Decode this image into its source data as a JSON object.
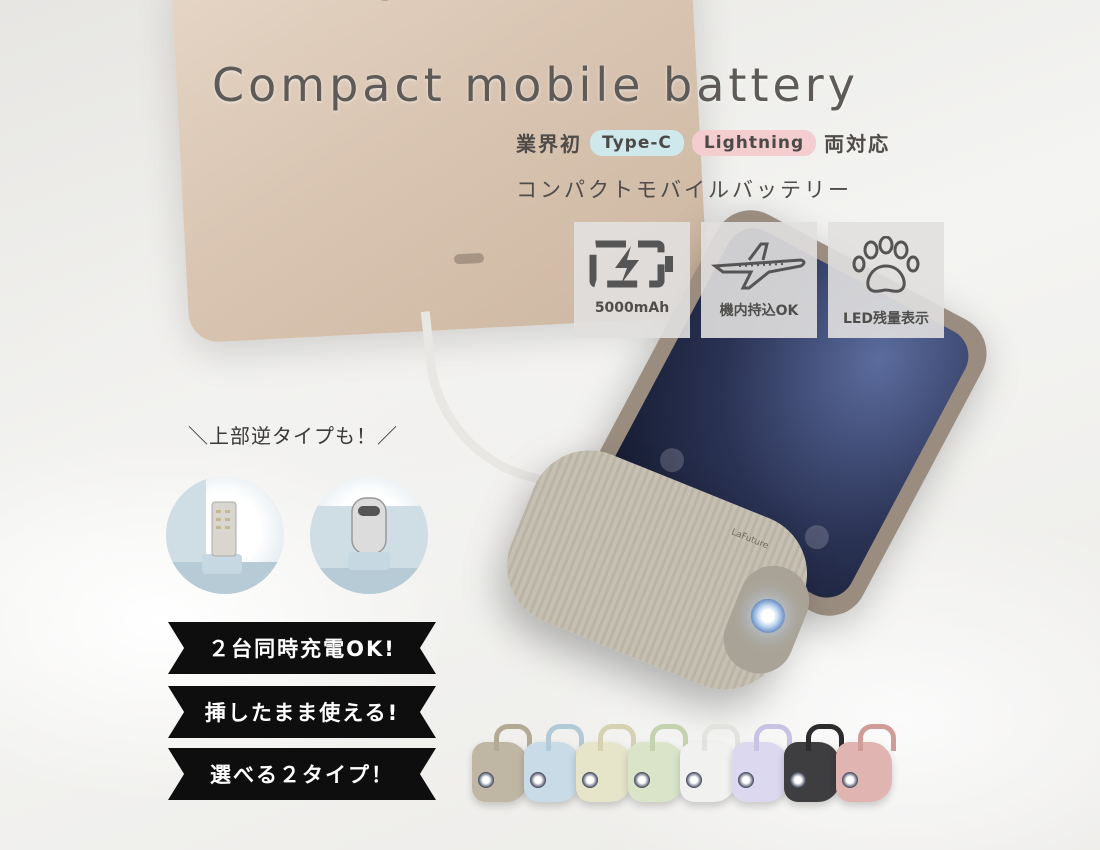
{
  "title": "Compact mobile battery",
  "subline": {
    "prefix": "業界初",
    "pill_typec": "Type-C",
    "pill_lightning": "Lightning",
    "suffix": "両対応"
  },
  "katakana": "コンパクトモバイルバッテリー",
  "features": [
    {
      "icon": "battery-charge-icon",
      "label": "5000mAh"
    },
    {
      "icon": "airplane-icon",
      "label": "機内持込OK"
    },
    {
      "icon": "paw-icon",
      "label": "LED残量表示"
    }
  ],
  "reverse_note": "＼上部逆タイプも！／",
  "connectors": [
    "lightning-connector",
    "type-c-connector"
  ],
  "ribbons": [
    "２台同時充電OK!",
    "挿したまま使える!",
    "選べる２タイプ！"
  ],
  "battery_brand": "LaFuture",
  "variants": [
    {
      "body": "#bfb6a3",
      "loop": "#b3aa96"
    },
    {
      "body": "#c9dbe6",
      "loop": "#b2c9d7"
    },
    {
      "body": "#e6e4c9",
      "loop": "#d4d2b3"
    },
    {
      "body": "#d9e4c9",
      "loop": "#c4d2b0"
    },
    {
      "body": "#f1f1ef",
      "loop": "#e2e2df"
    },
    {
      "body": "#dcd8ef",
      "loop": "#c8c2e4"
    },
    {
      "body": "#3e3e40",
      "loop": "#2c2c2e"
    },
    {
      "body": "#e0b4b0",
      "loop": "#cf9c97"
    }
  ]
}
